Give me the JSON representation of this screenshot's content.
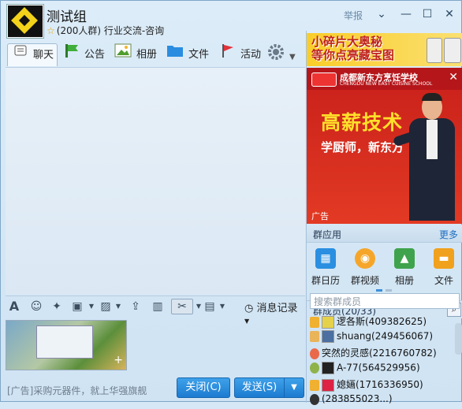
{
  "group": {
    "name": "测试组",
    "info": "(200人群) 行业交流-咨询",
    "report": "举报"
  },
  "window_controls": [
    "chevron-down-icon",
    "minimize-icon",
    "maximize-icon",
    "close-icon"
  ],
  "tabs": [
    {
      "label": "聊天",
      "icon": "chat-icon"
    },
    {
      "label": "公告",
      "icon": "announcement-icon"
    },
    {
      "label": "相册",
      "icon": "album-icon"
    },
    {
      "label": "文件",
      "icon": "folder-icon"
    },
    {
      "label": "活动",
      "icon": "flag-icon"
    }
  ],
  "toolbar": {
    "message_record": "消息记录"
  },
  "footer": {
    "ad_text": "[广告]采购元器件，就上华强旗舰",
    "close_label": "关闭(C)",
    "send_label": "发送(S)"
  },
  "banner_top": {
    "line1": "小碎片大奥秘",
    "line2": "等你点亮藏宝图"
  },
  "ad": {
    "school": "成都新东方烹饪学校",
    "school_en": "CHENGDU NEW EAST CUISINE SCHOOL",
    "headline": "高薪技术",
    "sub": "学厨师，新东方",
    "label": "广告"
  },
  "apps": {
    "title": "群应用",
    "more": "更多",
    "items": [
      {
        "label": "群日历",
        "color": "#2a8fe0"
      },
      {
        "label": "群视频",
        "color": "#f5a62a"
      },
      {
        "label": "相册",
        "color": "#3fa34d"
      },
      {
        "label": "文件",
        "color": "#f0a11e"
      }
    ]
  },
  "members": {
    "title": "群成员(20/33)",
    "search_placeholder": "搜索群成员",
    "list": [
      "逻各斯(409382625)",
      "shuang(249456067)",
      "突然的灵感(2216760782)",
      "A-77(564529956)",
      "媳婳(1716336950)",
      "(283855023...)"
    ]
  }
}
